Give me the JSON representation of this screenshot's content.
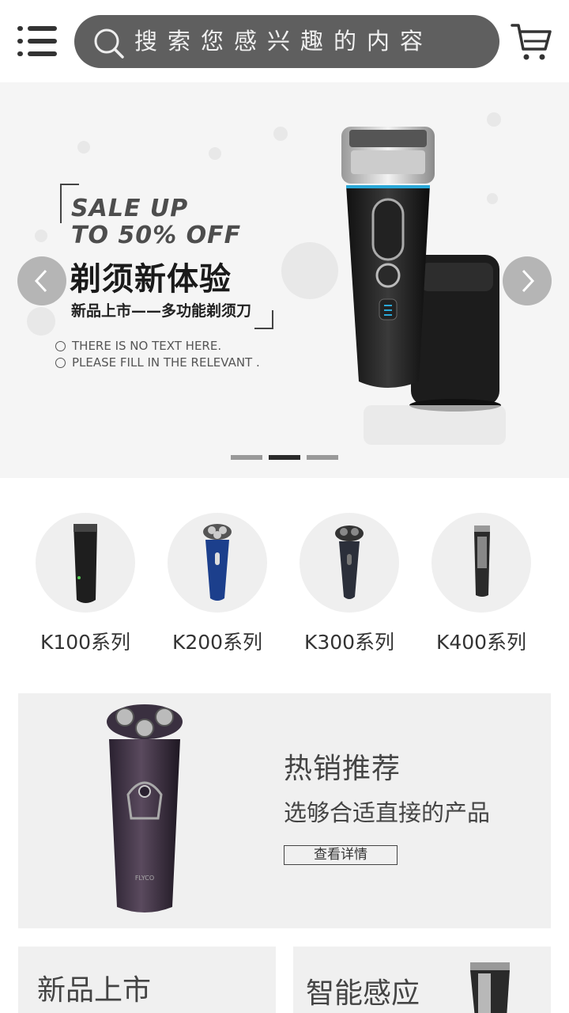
{
  "header": {
    "search_placeholder": "搜索您感兴趣的内容",
    "icons": [
      "menu-icon",
      "search-icon",
      "cart-icon"
    ]
  },
  "banner": {
    "sale_line1": "SALE UP",
    "sale_line2": "TO 50% OFF",
    "title": "剃须新体验",
    "subtitle": "新品上市——多功能剃须刀",
    "note1": "THERE IS NO TEXT HERE.",
    "note2": "PLEASE FILL IN THE RELEVANT .",
    "slide_count": 3,
    "active_slide": 2
  },
  "categories": [
    {
      "label": "K100系列"
    },
    {
      "label": "K200系列"
    },
    {
      "label": "K300系列"
    },
    {
      "label": "K400系列"
    }
  ],
  "hot": {
    "title": "热销推荐",
    "subtitle": "选够合适直接的产品",
    "button": "查看详情",
    "product_brand": "FLYCO"
  },
  "cards": [
    {
      "title": "新品上市"
    },
    {
      "title": "智能感应"
    }
  ],
  "colors": {
    "search_bg": "#5f5f5f",
    "banner_bg": "#f5f5f5",
    "panel_bg": "#f0f0f0",
    "indicator_active": "#2a2a2a"
  }
}
